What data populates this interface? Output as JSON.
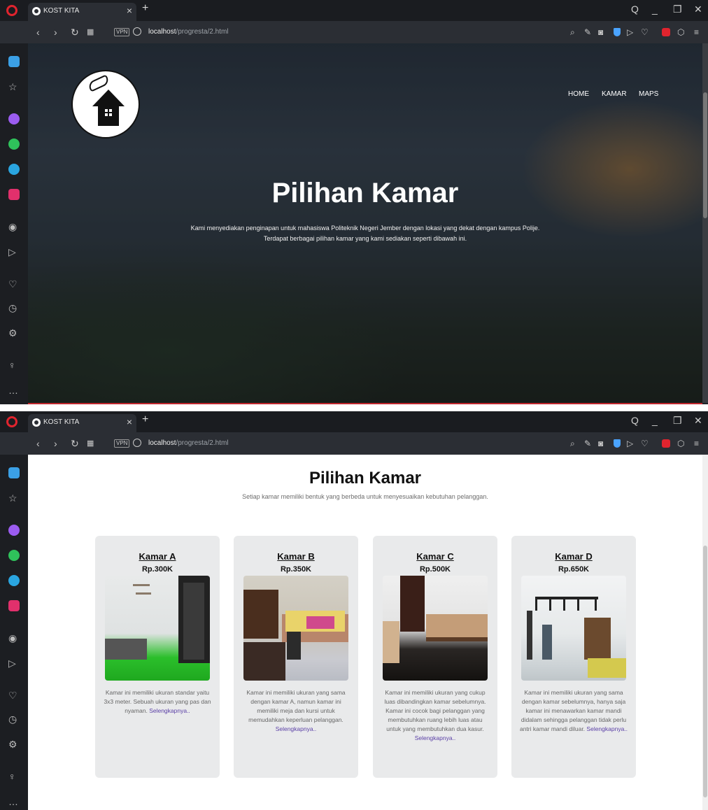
{
  "browser": {
    "tab_title": "KOST KITA",
    "tab_close": "×",
    "new_tab": "+",
    "url_host": "localhost",
    "url_path": "/progresta/2.html",
    "vpn_label": "VPN",
    "window_controls": [
      "Q",
      "_",
      "❐",
      "✕"
    ]
  },
  "hero": {
    "nav": [
      "HOME",
      "KAMAR",
      "MAPS"
    ],
    "title": "Pilihan Kamar",
    "subtitle_1": "Kami menyediakan penginapan untuk mahasiswa Politeknik Negeri Jember dengan lokasi yang dekat dengan kampus Polije.",
    "subtitle_2": "Terdapat berbagai pilihan kamar yang kami sediakan seperti dibawah ini."
  },
  "rooms_section": {
    "title": "Pilihan Kamar",
    "subtitle": "Setiap kamar memiliki bentuk yang berbeda untuk menyesuaikan kebutuhan pelanggan.",
    "read_more": "Selengkapnya..",
    "cards": [
      {
        "name": "Kamar A",
        "price": "Rp.300K",
        "desc": "Kamar ini memiliki ukuran standar yaitu 3x3 meter. Sebuah ukuran yang pas dan nyaman."
      },
      {
        "name": "Kamar B",
        "price": "Rp.350K",
        "desc": "Kamar ini memiliki ukuran yang sama dengan kamar A, namun kamar ini memiliki meja dan kursi untuk memudahkan keperluan pelanggan."
      },
      {
        "name": "Kamar C",
        "price": "Rp.500K",
        "desc": "Kamar ini memiliki ukuran yang cukup luas dibandingkan kamar sebelumnya. Kamar ini cocok bagi pelanggan yang membutuhkan ruang lebih luas atau untuk yang membutuhkan dua kasur."
      },
      {
        "name": "Kamar D",
        "price": "Rp.650K",
        "desc": "Kamar ini memiliki ukuran yang sama dengan kamar sebelumnya, hanya saja kamar ini menawarkan kamar mandi didalam sehingga pelanggan tidak perlu antri kamar mandi diluar."
      }
    ]
  },
  "colors": {
    "opera_red": "#e0242e",
    "link_purple": "#5a3fa6",
    "card_bg": "#e9eaeb"
  },
  "icons": {
    "sidebar": [
      "home-icon",
      "star-icon",
      "messenger-icon",
      "whatsapp-icon",
      "telegram-icon",
      "instagram-icon",
      "player-icon",
      "flow-icon",
      "heart-icon",
      "history-icon",
      "settings-icon",
      "lightbulb-icon",
      "more-icon"
    ]
  }
}
